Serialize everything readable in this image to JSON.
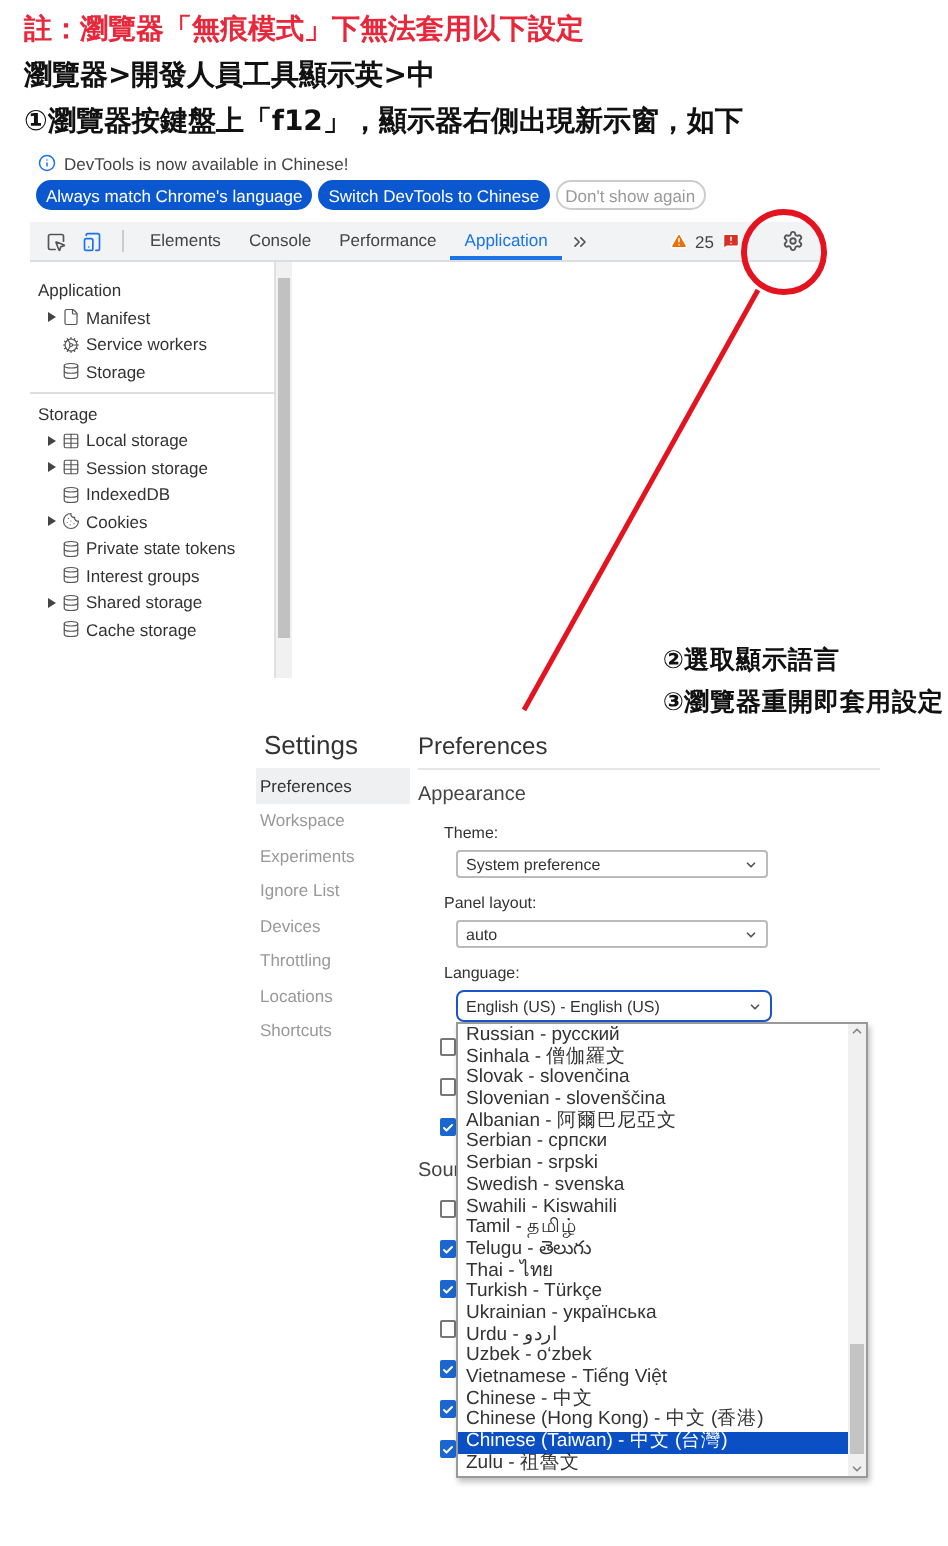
{
  "note": "註：瀏覽器「無痕模式」下無法套用以下設定",
  "path": "瀏覽器>開發人員工具顯示英>中",
  "step_1": "①瀏覽器按鍵盤上「f12」，顯示器右側出現新示窗，如下",
  "devtools": {
    "banner": {
      "message": "DevTools is now available in Chinese!",
      "buttons": [
        {
          "label": "Always match Chrome's language",
          "kind": "primary"
        },
        {
          "label": "Switch DevTools to Chinese",
          "kind": "primary"
        },
        {
          "label": "Don't show again",
          "kind": "secondary"
        }
      ]
    },
    "tabs": [
      {
        "label": "Elements",
        "selected": false
      },
      {
        "label": "Console",
        "selected": false
      },
      {
        "label": "Performance",
        "selected": false
      },
      {
        "label": "Application",
        "selected": true
      }
    ],
    "warnings": "25",
    "sidebar": [
      {
        "title": "Application",
        "items": [
          {
            "label": "Manifest",
            "kind": "file",
            "expandable": true
          },
          {
            "label": "Service workers",
            "kind": "gears",
            "expandable": false
          },
          {
            "label": "Storage",
            "kind": "database",
            "expandable": false
          }
        ]
      },
      {
        "title": "Storage",
        "items": [
          {
            "label": "Local storage",
            "kind": "table",
            "expandable": true
          },
          {
            "label": "Session storage",
            "kind": "table",
            "expandable": true
          },
          {
            "label": "IndexedDB",
            "kind": "database",
            "expandable": false
          },
          {
            "label": "Cookies",
            "kind": "cookie",
            "expandable": true
          },
          {
            "label": "Private state tokens",
            "kind": "database",
            "expandable": false
          },
          {
            "label": "Interest groups",
            "kind": "database",
            "expandable": false
          },
          {
            "label": "Shared storage",
            "kind": "database",
            "expandable": true
          },
          {
            "label": "Cache storage",
            "kind": "database",
            "expandable": false
          }
        ]
      }
    ]
  },
  "step_2": "②選取顯示語言",
  "step_3": "③瀏覽器重開即套用設定",
  "settings": {
    "title": "Settings",
    "nav": [
      {
        "label": "Preferences",
        "selected": true
      },
      {
        "label": "Workspace",
        "selected": false
      },
      {
        "label": "Experiments",
        "selected": false
      },
      {
        "label": "Ignore List",
        "selected": false
      },
      {
        "label": "Devices",
        "selected": false
      },
      {
        "label": "Throttling",
        "selected": false
      },
      {
        "label": "Locations",
        "selected": false
      },
      {
        "label": "Shortcuts",
        "selected": false
      }
    ],
    "heading": "Preferences",
    "section": "Appearance",
    "fields": [
      {
        "label": "Theme:",
        "value": "System preference",
        "focused": false
      },
      {
        "label": "Panel layout:",
        "value": "auto",
        "focused": false
      },
      {
        "label": "Language:",
        "value": "English (US) - English (US)",
        "focused": true
      }
    ],
    "checkboxes_before": [
      {
        "checked": false
      },
      {
        "checked": false
      },
      {
        "checked": true
      }
    ],
    "sources_heading": "Sour",
    "checkboxes_after": [
      {
        "checked": false
      },
      {
        "checked": true
      },
      {
        "checked": true
      },
      {
        "checked": false
      },
      {
        "checked": true
      },
      {
        "checked": true
      },
      {
        "checked": true
      }
    ],
    "language_options": [
      {
        "label": "Russian - русский",
        "selected": false
      },
      {
        "label": "Sinhala - 僧伽羅文",
        "selected": false
      },
      {
        "label": "Slovak - slovenčina",
        "selected": false
      },
      {
        "label": "Slovenian - slovenščina",
        "selected": false
      },
      {
        "label": "Albanian - 阿爾巴尼亞文",
        "selected": false
      },
      {
        "label": "Serbian - српски",
        "selected": false
      },
      {
        "label": "Serbian - srpski",
        "selected": false
      },
      {
        "label": "Swedish - svenska",
        "selected": false
      },
      {
        "label": "Swahili - Kiswahili",
        "selected": false
      },
      {
        "label": "Tamil - தமிழ்",
        "selected": false
      },
      {
        "label": "Telugu - తెలుగు",
        "selected": false
      },
      {
        "label": "Thai - ไทย",
        "selected": false
      },
      {
        "label": "Turkish - Türkçe",
        "selected": false
      },
      {
        "label": "Ukrainian - українська",
        "selected": false
      },
      {
        "label": "Urdu - اردو",
        "selected": false
      },
      {
        "label": "Uzbek - o‘zbek",
        "selected": false
      },
      {
        "label": "Vietnamese - Tiếng Việt",
        "selected": false
      },
      {
        "label": "Chinese - 中文",
        "selected": false
      },
      {
        "label": "Chinese (Hong Kong) - 中文 (香港)",
        "selected": false
      },
      {
        "label": "Chinese (Taiwan) - 中文 (台灣)",
        "selected": true
      },
      {
        "label": "Zulu - 祖魯文",
        "selected": false
      }
    ]
  }
}
